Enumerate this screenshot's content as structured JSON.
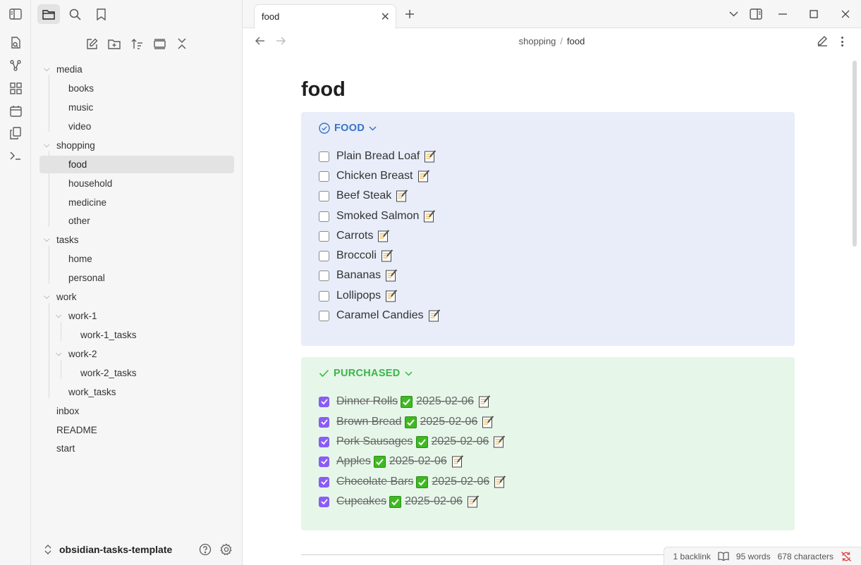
{
  "sidebar": {
    "vault_name": "obsidian-tasks-template",
    "tree": [
      {
        "label": "media",
        "depth": 0,
        "folder": true
      },
      {
        "label": "books",
        "depth": 1
      },
      {
        "label": "music",
        "depth": 1
      },
      {
        "label": "video",
        "depth": 1
      },
      {
        "label": "shopping",
        "depth": 0,
        "folder": true
      },
      {
        "label": "food",
        "depth": 1,
        "active": true
      },
      {
        "label": "household",
        "depth": 1
      },
      {
        "label": "medicine",
        "depth": 1
      },
      {
        "label": "other",
        "depth": 1
      },
      {
        "label": "tasks",
        "depth": 0,
        "folder": true
      },
      {
        "label": "home",
        "depth": 1
      },
      {
        "label": "personal",
        "depth": 1
      },
      {
        "label": "work",
        "depth": 0,
        "folder": true
      },
      {
        "label": "work-1",
        "depth": 1,
        "folder": true
      },
      {
        "label": "work-1_tasks",
        "depth": 2
      },
      {
        "label": "work-2",
        "depth": 1,
        "folder": true
      },
      {
        "label": "work-2_tasks",
        "depth": 2
      },
      {
        "label": "work_tasks",
        "depth": 1
      },
      {
        "label": "inbox",
        "depth": 0
      },
      {
        "label": "README",
        "depth": 0
      },
      {
        "label": "start",
        "depth": 0
      }
    ]
  },
  "tab": {
    "title": "food"
  },
  "breadcrumb": {
    "parent": "shopping",
    "separator": "/",
    "current": "food"
  },
  "note": {
    "title": "food",
    "food_callout": {
      "title": "FOOD",
      "tasks": [
        "Plain Bread Loaf",
        "Chicken Breast",
        "Beef Steak",
        "Smoked Salmon",
        "Carrots",
        "Broccoli",
        "Bananas",
        "Lollipops",
        "Caramel Candies"
      ]
    },
    "purchased_callout": {
      "title": "PURCHASED",
      "tasks": [
        {
          "text": "Dinner Rolls",
          "date": "2025-02-06"
        },
        {
          "text": "Brown Bread",
          "date": "2025-02-06"
        },
        {
          "text": "Pork Sausages",
          "date": "2025-02-06"
        },
        {
          "text": "Apples",
          "date": "2025-02-06"
        },
        {
          "text": "Chocolate Bars",
          "date": "2025-02-06"
        },
        {
          "text": "Cupcakes",
          "date": "2025-02-06"
        }
      ]
    }
  },
  "status": {
    "backlinks": "1 backlink",
    "words": "95 words",
    "characters": "678 characters"
  },
  "colors": {
    "accent": "#8a5cf5",
    "food_callout": "#3574c8",
    "purchased_callout": "#3ab54a",
    "done_check": "#3fb922"
  }
}
